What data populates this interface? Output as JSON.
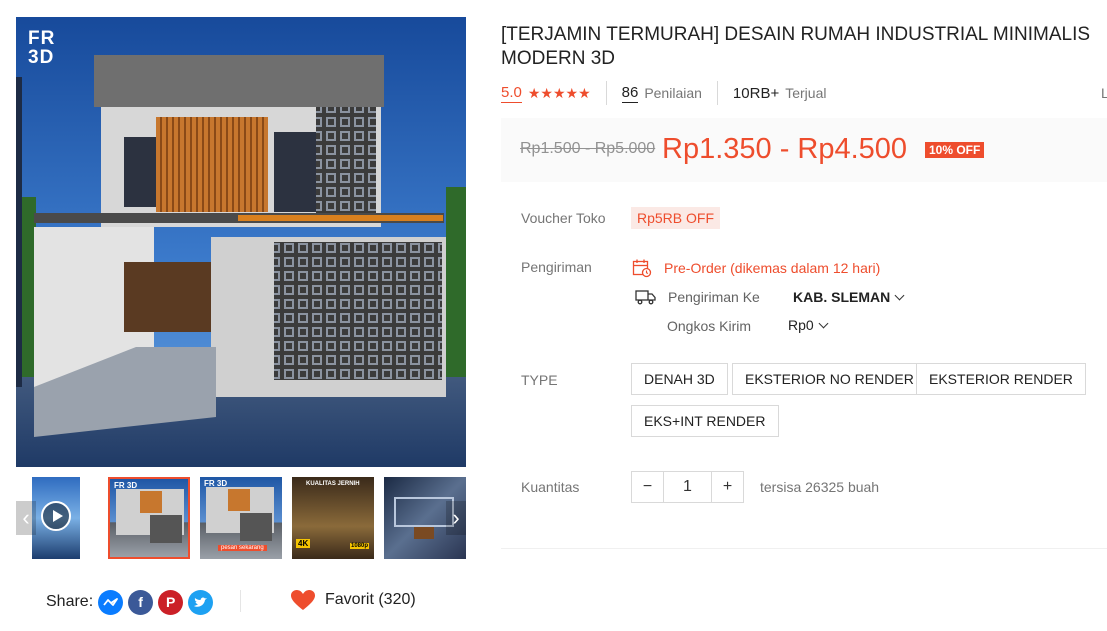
{
  "gallery": {
    "logo_text": "FR\n3D",
    "prev_icon": "‹",
    "next_icon": "›",
    "thumbs": [
      {
        "name": "video-thumb"
      },
      {
        "name": "thumb-front-view",
        "label": "FR 3D"
      },
      {
        "name": "thumb-front-view-2",
        "label": "FR 3D",
        "caption": "pesan sekarang"
      },
      {
        "name": "thumb-interior",
        "label": "KUALITAS JERNIH",
        "badge": "4K",
        "badge2": "1080p"
      },
      {
        "name": "thumb-room"
      }
    ]
  },
  "share": {
    "label": "Share:",
    "icons": [
      "messenger-icon",
      "facebook-icon",
      "pinterest-icon",
      "twitter-icon"
    ]
  },
  "favorite": {
    "label": "Favorit (320)"
  },
  "product": {
    "title": "[TERJAMIN TERMURAH] DESAIN RUMAH INDUSTRIAL MINIMALIS MODERN 3D",
    "rating_value": "5.0",
    "stars": "★★★★★",
    "rating_count": "86",
    "rating_label": "Penilaian",
    "sold_count": "10RB+",
    "sold_label": "Terjual",
    "cut_text": "L",
    "old_price": "Rp1.500 - Rp5.000",
    "price": "Rp1.350 - Rp4.500",
    "discount": "10% OFF"
  },
  "voucher": {
    "label": "Voucher Toko",
    "value": "Rp5RB OFF"
  },
  "shipping": {
    "label": "Pengiriman",
    "preorder": "Pre-Order (dikemas dalam 12 hari)",
    "to_label": "Pengiriman Ke",
    "to_value": "KAB. SLEMAN",
    "cost_label": "Ongkos Kirim",
    "cost_value": "Rp0"
  },
  "type": {
    "label": "TYPE",
    "options": [
      "DENAH 3D",
      "EKSTERIOR NO RENDER",
      "EKSTERIOR RENDER",
      "EKS+INT RENDER"
    ]
  },
  "quantity": {
    "label": "Kuantitas",
    "minus": "−",
    "value": "1",
    "plus": "+",
    "stock": "tersisa 26325 buah"
  },
  "colors": {
    "accent": "#ee4d2d",
    "price_bg": "#fafafa",
    "voucher_bg": "#fbe9e5"
  }
}
